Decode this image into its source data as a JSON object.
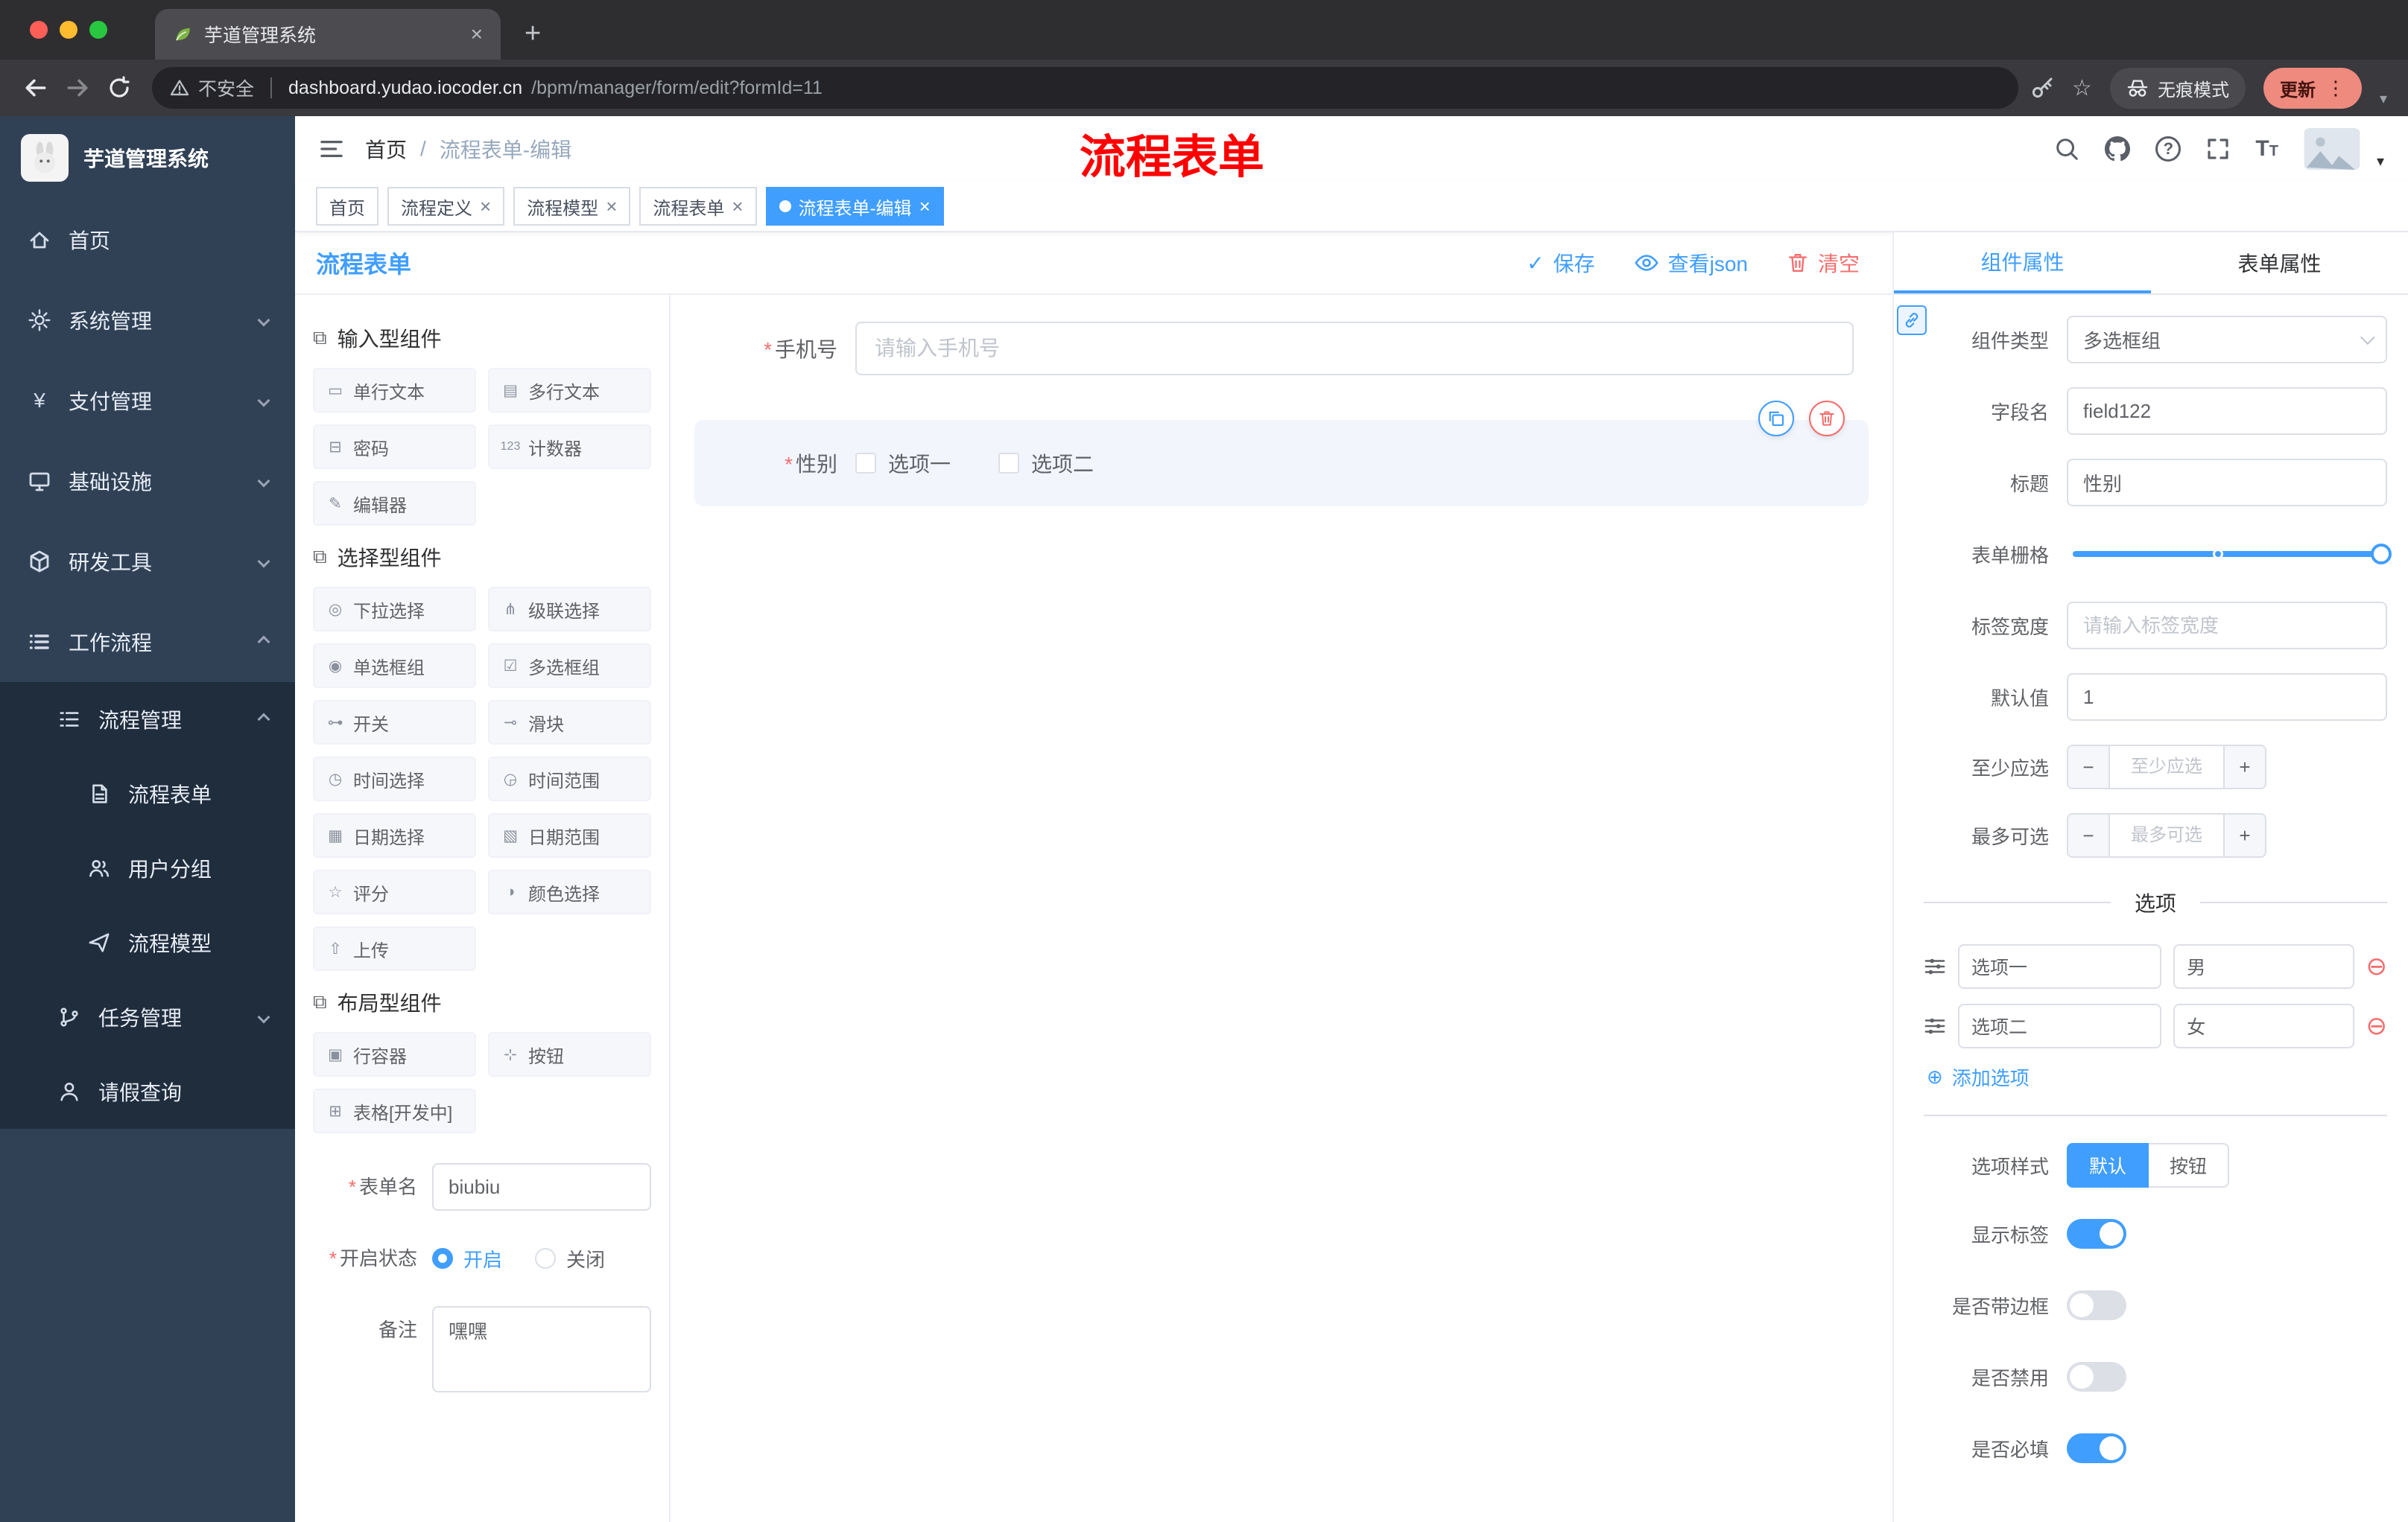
{
  "browser": {
    "tab_title": "芋道管理系统",
    "security_label": "不安全",
    "url_domain": "dashboard.yudao.iocoder.cn",
    "url_path": "/bpm/manager/form/edit?formId=11",
    "incognito_label": "无痕模式",
    "update_label": "更新"
  },
  "annotation": "流程表单",
  "icons": {
    "close": "×",
    "plus": "+",
    "kebab": "⋮",
    "question": "?",
    "star": "☆",
    "check": "✓",
    "caret": "▾",
    "font_large": "T",
    "font_small": "T",
    "minus_circle": "⊖",
    "plus_circle": "⊕",
    "minus": "−",
    "plus_small": "+",
    "required": "*",
    "slash": "/"
  },
  "sidebar": {
    "logo_title": "芋道管理系统",
    "items": [
      {
        "label": "首页"
      },
      {
        "label": "系统管理"
      },
      {
        "label": "支付管理"
      },
      {
        "label": "基础设施"
      },
      {
        "label": "研发工具"
      },
      {
        "label": "工作流程"
      },
      {
        "label": "流程管理"
      },
      {
        "label": "流程表单"
      },
      {
        "label": "用户分组"
      },
      {
        "label": "流程模型"
      },
      {
        "label": "任务管理"
      },
      {
        "label": "请假查询"
      }
    ]
  },
  "header": {
    "breadcrumb_home": "首页",
    "breadcrumb_current": "流程表单-编辑"
  },
  "tags": [
    {
      "label": "首页"
    },
    {
      "label": "流程定义"
    },
    {
      "label": "流程模型"
    },
    {
      "label": "流程表单"
    },
    {
      "label": "流程表单-编辑"
    }
  ],
  "designer": {
    "title": "流程表单",
    "actions": {
      "save": "保存",
      "view_json": "查看json",
      "clear": "清空"
    },
    "sections": [
      {
        "icon": "⧉",
        "title": "输入型组件",
        "items": [
          {
            "icon": "▭",
            "label": "单行文本"
          },
          {
            "icon": "▤",
            "label": "多行文本"
          },
          {
            "icon": "⊟",
            "label": "密码"
          },
          {
            "icon": "123",
            "label": "计数器"
          },
          {
            "icon": "✎",
            "label": "编辑器"
          }
        ]
      },
      {
        "icon": "⧉",
        "title": "选择型组件",
        "items": [
          {
            "icon": "◎",
            "label": "下拉选择"
          },
          {
            "icon": "⋔",
            "label": "级联选择"
          },
          {
            "icon": "◉",
            "label": "单选框组"
          },
          {
            "icon": "☑",
            "label": "多选框组"
          },
          {
            "icon": "⊶",
            "label": "开关"
          },
          {
            "icon": "⊸",
            "label": "滑块"
          },
          {
            "icon": "◷",
            "label": "时间选择"
          },
          {
            "icon": "◶",
            "label": "时间范围"
          },
          {
            "icon": "▦",
            "label": "日期选择"
          },
          {
            "icon": "▧",
            "label": "日期范围"
          },
          {
            "icon": "☆",
            "label": "评分"
          },
          {
            "icon": "◑",
            "label": "颜色选择"
          },
          {
            "icon": "⇧",
            "label": "上传"
          }
        ]
      },
      {
        "icon": "⧉",
        "title": "布局型组件",
        "items": [
          {
            "icon": "▣",
            "label": "行容器"
          },
          {
            "icon": "⊹",
            "label": "按钮"
          },
          {
            "icon": "⊞",
            "label": "表格[开发中]"
          }
        ]
      }
    ],
    "form": {
      "name_label": "表单名",
      "name_value": "biubiu",
      "status_label": "开启状态",
      "status_on": "开启",
      "status_off": "关闭",
      "remark_label": "备注",
      "remark_value": "嘿嘿"
    },
    "canvas": {
      "phone_label": "手机号",
      "phone_placeholder": "请输入手机号",
      "gender_label": "性别",
      "gender_option1": "选项一",
      "gender_option2": "选项二"
    }
  },
  "props": {
    "tab_component": "组件属性",
    "tab_form": "表单属性",
    "type_label": "组件类型",
    "type_value": "多选框组",
    "field_label": "字段名",
    "field_value": "field122",
    "title_label": "标题",
    "title_value": "性别",
    "grid_label": "表单栅格",
    "width_label": "标签宽度",
    "width_placeholder": "请输入标签宽度",
    "default_label": "默认值",
    "default_value": "1",
    "min_label": "至少应选",
    "min_placeholder": "至少应选",
    "max_label": "最多可选",
    "max_placeholder": "最多可选",
    "options_divider": "选项",
    "options": [
      {
        "label": "选项一",
        "value": "男"
      },
      {
        "label": "选项二",
        "value": "女"
      }
    ],
    "add_option": "添加选项",
    "style_label": "选项样式",
    "style_default": "默认",
    "style_button": "按钮",
    "switches": [
      {
        "label": "显示标签",
        "on": true
      },
      {
        "label": "是否带边框",
        "on": false
      },
      {
        "label": "是否禁用",
        "on": false
      },
      {
        "label": "是否必填",
        "on": true
      }
    ]
  }
}
